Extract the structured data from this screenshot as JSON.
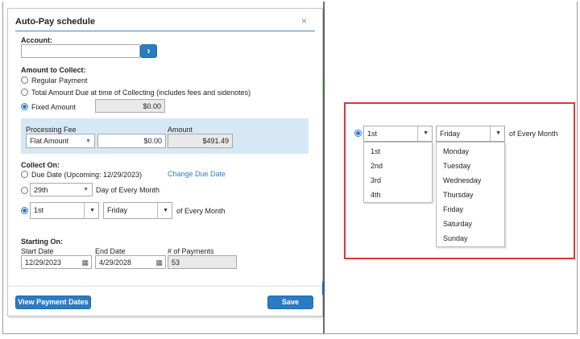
{
  "modal": {
    "title": "Auto-Pay schedule",
    "close": "×",
    "account_label": "Account:",
    "account_value": "",
    "account_arrow": "›",
    "amount_to_collect_label": "Amount to Collect:",
    "option_regular": "Regular Payment",
    "option_total": "Total Amount Due at time of Collecting (includes fees and sidenotes)",
    "option_fixed": "Fixed Amount",
    "fixed_amount_value": "$0.00",
    "processing_fee_label": "Processing Fee",
    "processing_fee_type": "Flat Amount",
    "processing_fee_value": "$0.00",
    "amount_label": "Amount",
    "amount_value": "$491.49",
    "collect_on_label": "Collect On:",
    "option_due_date": "Due Date (Upcoming: 12/29/2023)",
    "change_due_date": "Change Due Date",
    "day_value": "29th",
    "day_of_month_text": "Day of Every Month",
    "week_ordinal_value": "1st",
    "weekday_value": "Friday",
    "of_every_month_text": "of Every Month",
    "starting_on_label": "Starting On:",
    "start_date_label": "Start Date",
    "start_date_value": "12/29/2023",
    "end_date_label": "End Date",
    "end_date_value": "4/29/2028",
    "num_payments_label": "# of Payments",
    "num_payments_value": "53",
    "view_dates_button": "View Payment Dates",
    "save_button": "Save"
  },
  "zoom": {
    "ordinal_value": "1st",
    "weekday_value": "Friday",
    "of_every_month_text": "of Every Month",
    "ordinal_options": [
      "1st",
      "2nd",
      "3rd",
      "4th"
    ],
    "weekday_options": [
      "Monday",
      "Tuesday",
      "Wednesday",
      "Thursday",
      "Friday",
      "Saturday",
      "Sunday"
    ]
  },
  "colors": {
    "accent": "#2b7bc4",
    "highlight_border": "#d9383a",
    "fee_panel": "#d6e8f5"
  }
}
